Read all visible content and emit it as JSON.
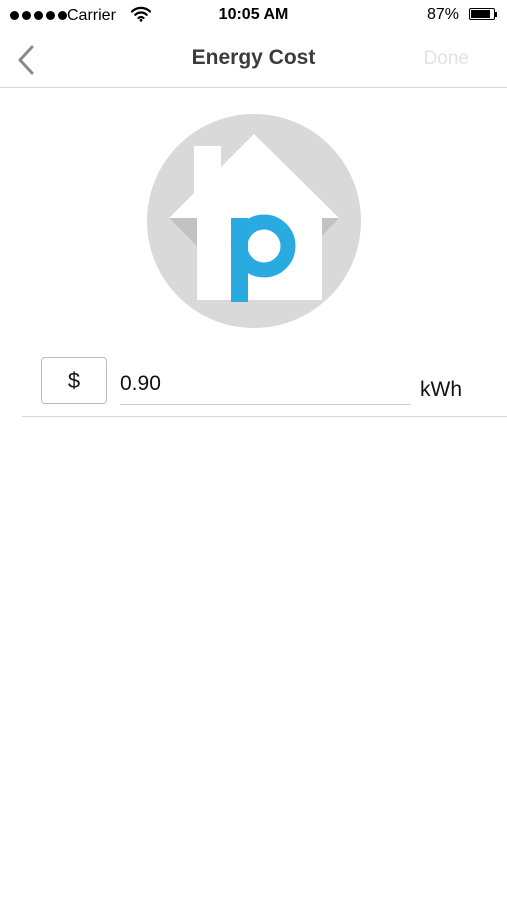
{
  "status_bar": {
    "carrier": "Carrier",
    "time": "10:05 AM",
    "battery_percent": "87%",
    "battery_level": 0.87,
    "signal_dots": 5
  },
  "nav": {
    "title": "Energy Cost",
    "done_label": "Done",
    "back_icon": "chevron-left-icon"
  },
  "logo": {
    "letter": "p",
    "circle_color": "#d9d9d9",
    "accent_color": "#29abe2"
  },
  "cost": {
    "currency_label": "$",
    "value": "0.90",
    "unit": "kWh"
  }
}
